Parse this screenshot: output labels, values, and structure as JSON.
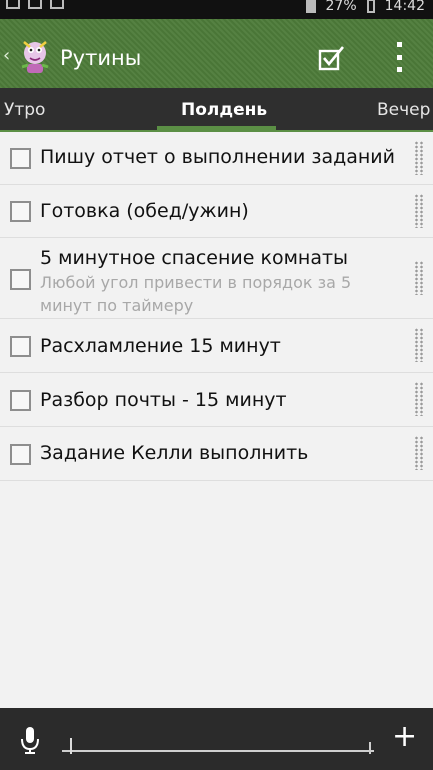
{
  "status_bar": {
    "battery": "27%",
    "time": "14:42"
  },
  "action_bar": {
    "title": "Рутины",
    "icons": [
      "back-chevron-icon",
      "app-logo-icon",
      "checkbox-check-icon",
      "overflow-menu-icon"
    ]
  },
  "tabs": [
    {
      "label": "Утро"
    },
    {
      "label": "Полдень"
    },
    {
      "label": "Вечер"
    }
  ],
  "tasks": [
    {
      "title": "Пишу отчет о выполнении заданий",
      "subtitle": ""
    },
    {
      "title": "Готовка (обед/ужин)",
      "subtitle": ""
    },
    {
      "title": "5 минутное спасение комнаты",
      "subtitle": "Любой угол привести в порядок за 5 минут по таймеру"
    },
    {
      "title": "Расхламление 15 минут",
      "subtitle": ""
    },
    {
      "title": "Разбор почты - 15 минут",
      "subtitle": ""
    },
    {
      "title": "Задание Келли выполнить",
      "subtitle": ""
    }
  ],
  "bottom_bar": {
    "input_value": "",
    "icons": [
      "microphone-icon",
      "plus-icon"
    ]
  },
  "colors": {
    "action_bar": "#4e7c3a",
    "tab_bar": "#2f2f2f",
    "accent": "#5b8f45",
    "background": "#f2f2f2",
    "bottom_bar": "#2b2b2b"
  }
}
